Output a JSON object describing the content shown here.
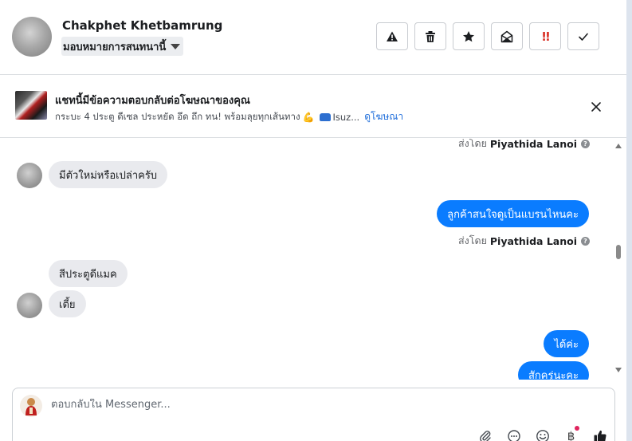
{
  "header": {
    "contact_name": "Chakphet Khetbamrung",
    "assign_label": "มอบหมายการสนทนานี้",
    "toolbar": [
      {
        "name": "spam-button",
        "icon": "warning-icon"
      },
      {
        "name": "delete-button",
        "icon": "trash-icon"
      },
      {
        "name": "star-button",
        "icon": "star-icon"
      },
      {
        "name": "mark-unread-button",
        "icon": "envelope-open-icon"
      },
      {
        "name": "priority-button",
        "icon": "exclamation-icon",
        "label": "!!"
      },
      {
        "name": "done-button",
        "icon": "check-icon"
      }
    ]
  },
  "ad": {
    "title": "แชทนี้มีข้อความตอบกลับต่อโฆษณาของคุณ",
    "subtitle_part1": "กระบะ 4 ประตู ดีเซล ประหยัด อึด ถึก ทน! พร้อมลุยทุกเส้นทาง",
    "subtitle_part2": "Isuz...",
    "link": "ดูโฆษณา"
  },
  "messages": {
    "sent_by_prefix": "ส่งโดย",
    "sender": "Piyathida Lanoi",
    "items": [
      {
        "direction": "in",
        "text": "มีตัวใหม่หรือเปล่าครับ"
      },
      {
        "direction": "out",
        "text": "ลูกค้าสนใจดูเป็นแบรนไหนคะ"
      },
      {
        "direction": "in",
        "text": "สีประตูดีแมค"
      },
      {
        "direction": "in",
        "text": "เตี้ย"
      },
      {
        "direction": "out",
        "text": "ได้ค่ะ"
      },
      {
        "direction": "out",
        "text": "สักครู่นะคะ"
      }
    ]
  },
  "composer": {
    "placeholder": "ตอบกลับใน Messenger...",
    "baht_symbol": "฿"
  },
  "colors": {
    "accent": "#0a7cff",
    "incoming_bubble": "#e9eaee",
    "link": "#216fdb"
  }
}
